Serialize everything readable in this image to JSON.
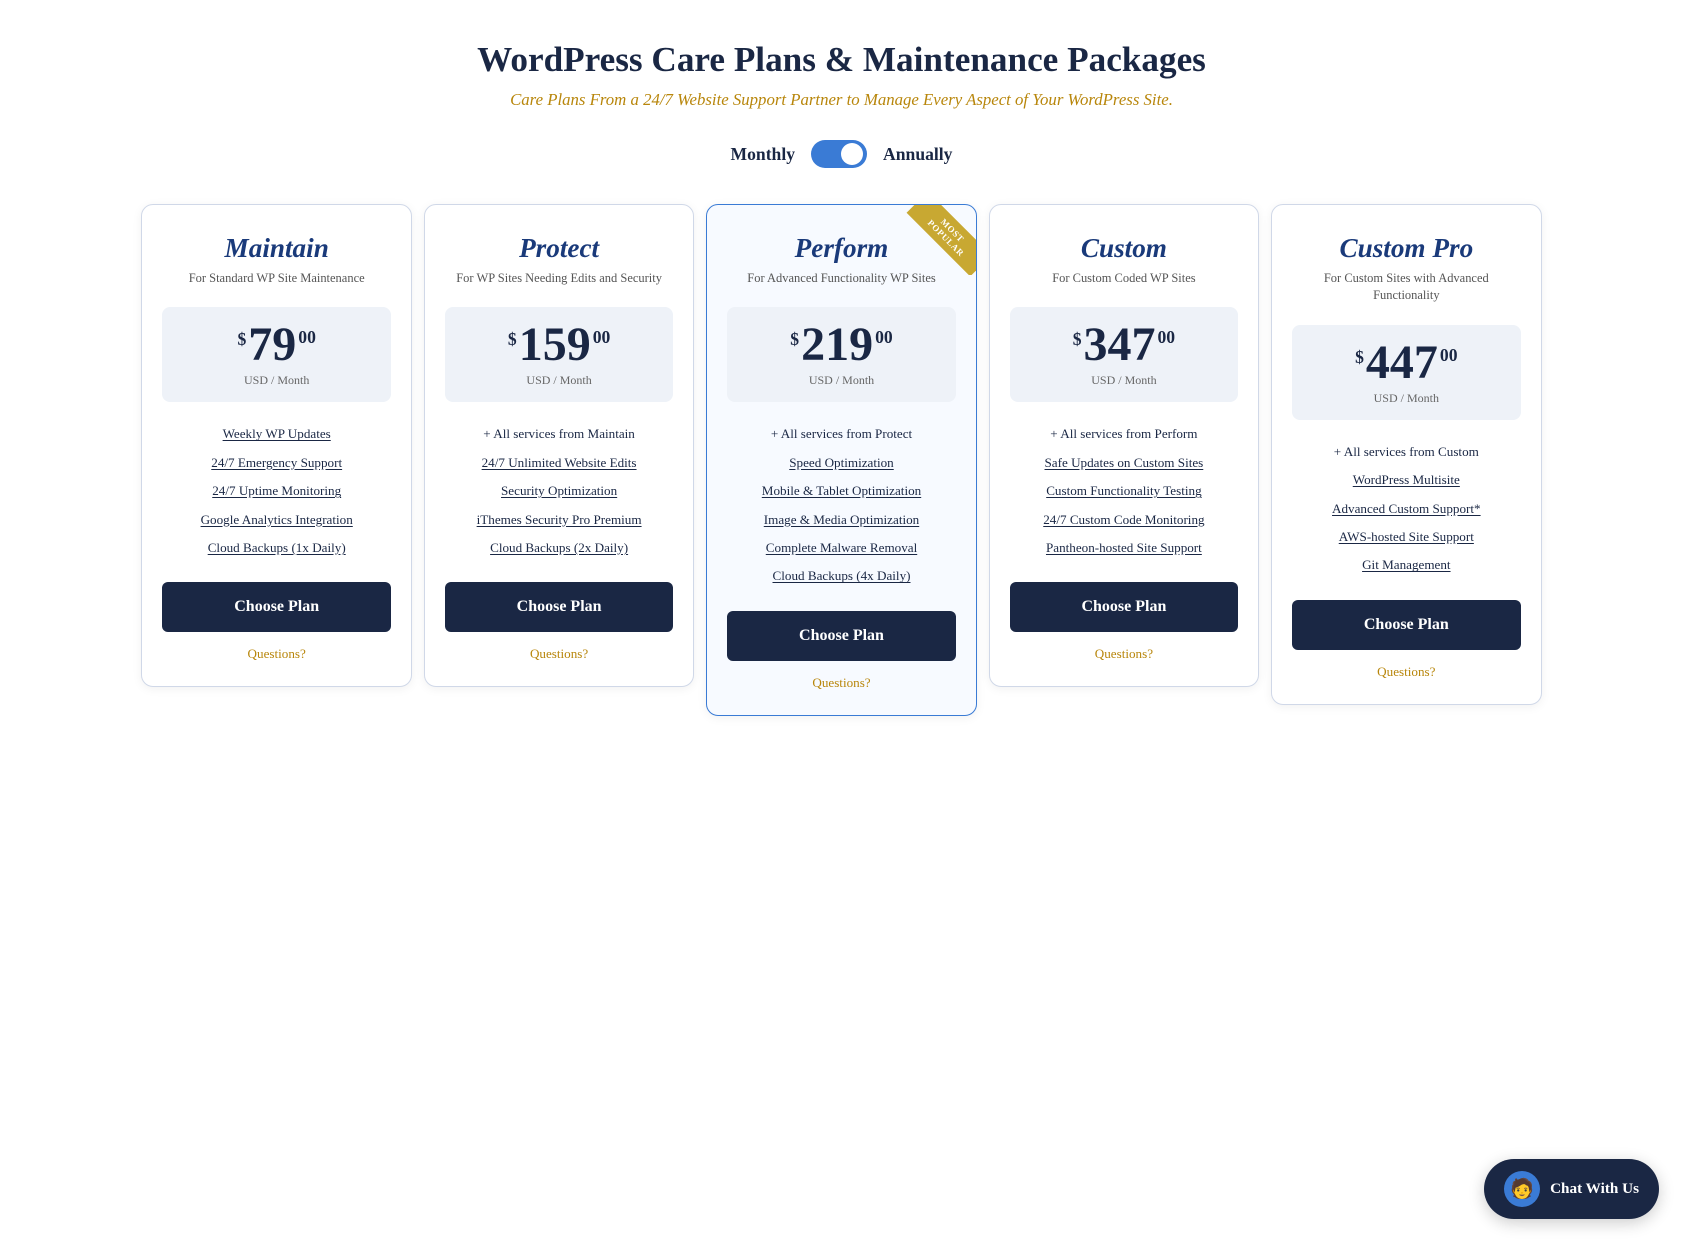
{
  "header": {
    "title": "WordPress Care Plans & Maintenance Packages",
    "subtitle": "Care Plans From a 24/7 Website Support Partner to Manage Every Aspect of Your WordPress Site."
  },
  "billing": {
    "monthly_label": "Monthly",
    "annually_label": "Annually",
    "toggle_state": "annually"
  },
  "plans": [
    {
      "id": "maintain",
      "name": "Maintain",
      "desc": "For Standard WP Site Maintenance",
      "price_dollar": "$",
      "price_amount": "79",
      "price_cents": "00",
      "price_period": "USD / Month",
      "most_popular": false,
      "features": [
        {
          "text": "Weekly WP Updates",
          "underline": true
        },
        {
          "text": "24/7 Emergency Support",
          "underline": true
        },
        {
          "text": "24/7 Uptime Monitoring",
          "underline": true
        },
        {
          "text": "Google Analytics Integration",
          "underline": true
        },
        {
          "text": "Cloud Backups (1x Daily)",
          "underline": true
        }
      ],
      "cta_label": "Choose Plan",
      "questions_label": "Questions?"
    },
    {
      "id": "protect",
      "name": "Protect",
      "desc": "For WP Sites Needing Edits and Security",
      "price_dollar": "$",
      "price_amount": "159",
      "price_cents": "00",
      "price_period": "USD / Month",
      "most_popular": false,
      "features": [
        {
          "text": "+ All services from Maintain",
          "underline": false
        },
        {
          "text": "24/7 Unlimited Website Edits",
          "underline": true
        },
        {
          "text": "Security Optimization",
          "underline": true
        },
        {
          "text": "iThemes Security Pro Premium",
          "underline": true
        },
        {
          "text": "Cloud Backups (2x Daily)",
          "underline": true
        }
      ],
      "cta_label": "Choose Plan",
      "questions_label": "Questions?"
    },
    {
      "id": "perform",
      "name": "Perform",
      "desc": "For Advanced Functionality WP Sites",
      "price_dollar": "$",
      "price_amount": "219",
      "price_cents": "00",
      "price_period": "USD / Month",
      "most_popular": true,
      "most_popular_label": "MOST POPULAR",
      "features": [
        {
          "text": "+ All services from Protect",
          "underline": false
        },
        {
          "text": "Speed Optimization",
          "underline": true
        },
        {
          "text": "Mobile & Tablet Optimization",
          "underline": true
        },
        {
          "text": "Image & Media Optimization",
          "underline": true
        },
        {
          "text": "Complete Malware Removal",
          "underline": true
        },
        {
          "text": "Cloud Backups (4x Daily)",
          "underline": true
        }
      ],
      "cta_label": "Choose Plan",
      "questions_label": "Questions?"
    },
    {
      "id": "custom",
      "name": "Custom",
      "desc": "For Custom Coded WP Sites",
      "price_dollar": "$",
      "price_amount": "347",
      "price_cents": "00",
      "price_period": "USD / Month",
      "most_popular": false,
      "features": [
        {
          "text": "+ All services from Perform",
          "underline": false
        },
        {
          "text": "Safe Updates on Custom Sites",
          "underline": true
        },
        {
          "text": "Custom Functionality Testing",
          "underline": true
        },
        {
          "text": "24/7 Custom Code Monitoring",
          "underline": true
        },
        {
          "text": "Pantheon-hosted Site Support",
          "underline": true
        }
      ],
      "cta_label": "Choose Plan",
      "questions_label": "Questions?"
    },
    {
      "id": "custom-pro",
      "name": "Custom Pro",
      "desc": "For Custom Sites with Advanced Functionality",
      "price_dollar": "$",
      "price_amount": "447",
      "price_cents": "00",
      "price_period": "USD / Month",
      "most_popular": false,
      "features": [
        {
          "text": "+ All services from Custom",
          "underline": false
        },
        {
          "text": "WordPress Multisite",
          "underline": true
        },
        {
          "text": "Advanced Custom Support*",
          "underline": true
        },
        {
          "text": "AWS-hosted Site Support",
          "underline": true
        },
        {
          "text": "Git Management",
          "underline": true
        }
      ],
      "cta_label": "Choose Plan",
      "questions_label": "Questions?"
    }
  ],
  "chat_widget": {
    "label": "Chat With Us",
    "icon": "💬"
  }
}
